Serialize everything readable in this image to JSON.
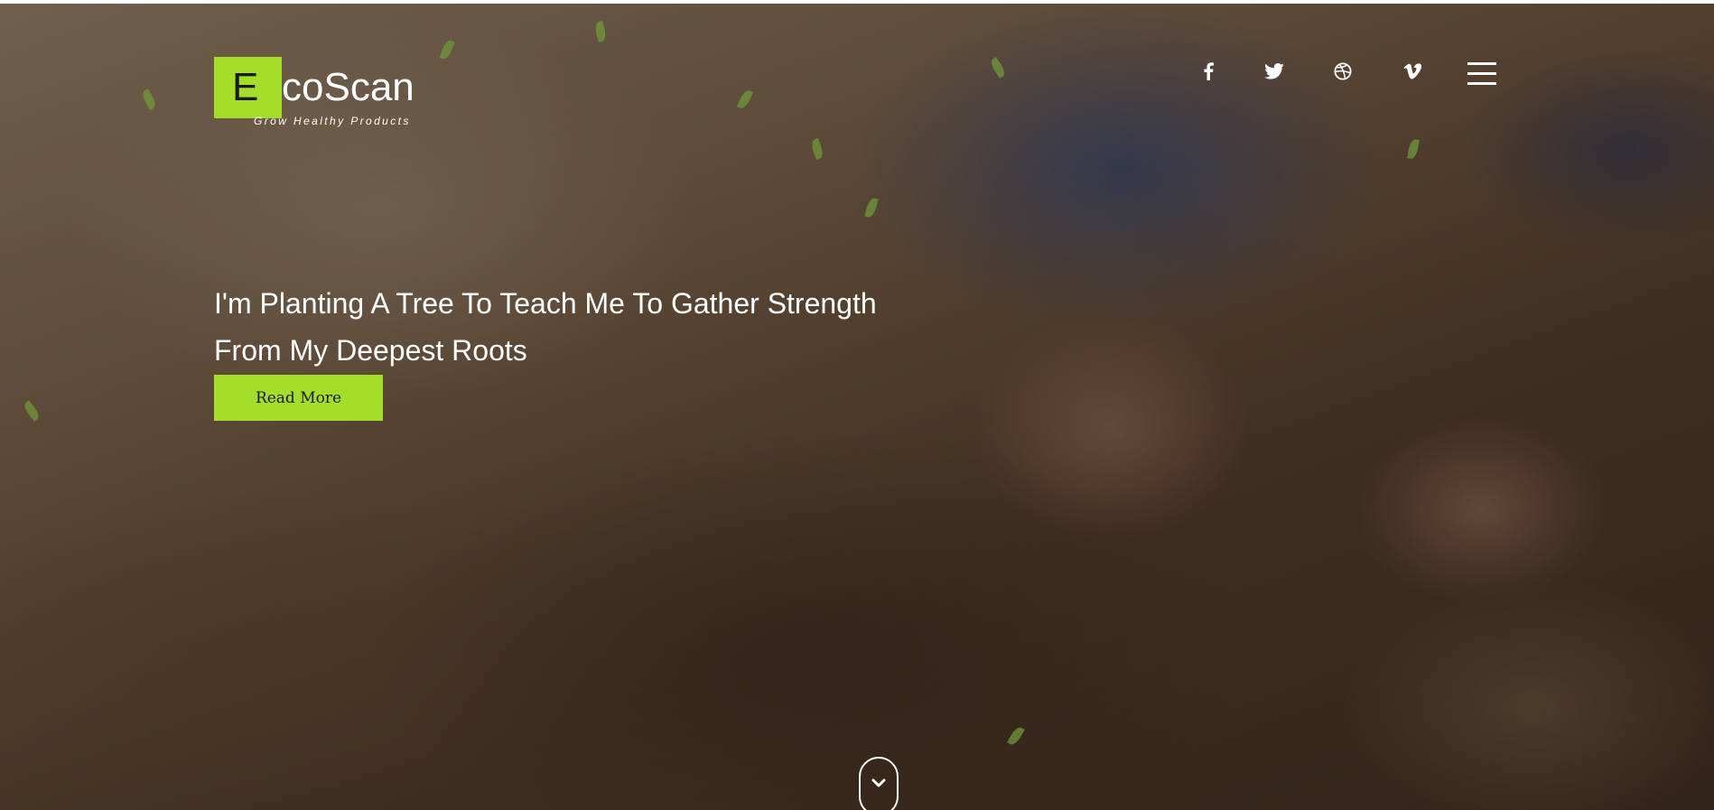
{
  "brand": {
    "logo_letter": "E",
    "logo_rest": "coScan",
    "tagline": "Grow Healthy Products",
    "accent_color": "#a4de2a"
  },
  "header": {
    "social_links": [
      {
        "name": "facebook",
        "icon": "facebook-icon"
      },
      {
        "name": "twitter",
        "icon": "twitter-icon"
      },
      {
        "name": "dribbble",
        "icon": "dribbble-icon"
      },
      {
        "name": "vimeo",
        "icon": "vimeo-icon"
      }
    ],
    "menu_icon": "hamburger-menu-icon"
  },
  "hero": {
    "headline_line1": "I'm Planting A Tree To Teach Me To Gather Strength",
    "headline_line2": "From My Deepest Roots",
    "cta_label": "Read More",
    "scroll_icon": "chevron-down-icon"
  }
}
